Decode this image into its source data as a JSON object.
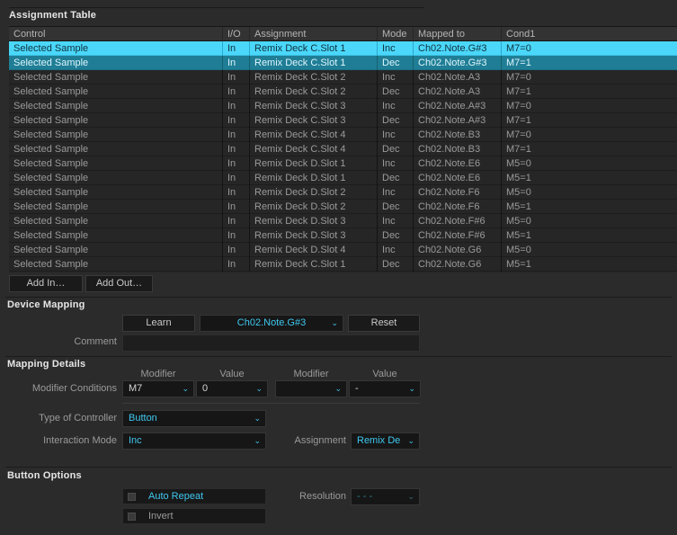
{
  "window": {
    "title": "Assignment Table"
  },
  "table": {
    "columns": [
      "Control",
      "I/O",
      "Assignment",
      "Mode",
      "Mapped to",
      "Cond1"
    ],
    "rows": [
      {
        "control": "Selected Sample",
        "io": "In",
        "assignment": "Remix Deck C.Slot 1",
        "mode": "Inc",
        "mapped": "Ch02.Note.G#3",
        "cond1": "M7=0",
        "state": "selected-primary"
      },
      {
        "control": "Selected Sample",
        "io": "In",
        "assignment": "Remix Deck C.Slot 1",
        "mode": "Dec",
        "mapped": "Ch02.Note.G#3",
        "cond1": "M7=1",
        "state": "selected-secondary"
      },
      {
        "control": "Selected Sample",
        "io": "In",
        "assignment": "Remix Deck C.Slot 2",
        "mode": "Inc",
        "mapped": "Ch02.Note.A3",
        "cond1": "M7=0",
        "state": "normal"
      },
      {
        "control": "Selected Sample",
        "io": "In",
        "assignment": "Remix Deck C.Slot 2",
        "mode": "Dec",
        "mapped": "Ch02.Note.A3",
        "cond1": "M7=1",
        "state": "normal"
      },
      {
        "control": "Selected Sample",
        "io": "In",
        "assignment": "Remix Deck C.Slot 3",
        "mode": "Inc",
        "mapped": "Ch02.Note.A#3",
        "cond1": "M7=0",
        "state": "normal"
      },
      {
        "control": "Selected Sample",
        "io": "In",
        "assignment": "Remix Deck C.Slot 3",
        "mode": "Dec",
        "mapped": "Ch02.Note.A#3",
        "cond1": "M7=1",
        "state": "normal"
      },
      {
        "control": "Selected Sample",
        "io": "In",
        "assignment": "Remix Deck C.Slot 4",
        "mode": "Inc",
        "mapped": "Ch02.Note.B3",
        "cond1": "M7=0",
        "state": "normal"
      },
      {
        "control": "Selected Sample",
        "io": "In",
        "assignment": "Remix Deck C.Slot 4",
        "mode": "Dec",
        "mapped": "Ch02.Note.B3",
        "cond1": "M7=1",
        "state": "normal"
      },
      {
        "control": "Selected Sample",
        "io": "In",
        "assignment": "Remix Deck D.Slot 1",
        "mode": "Inc",
        "mapped": "Ch02.Note.E6",
        "cond1": "M5=0",
        "state": "normal"
      },
      {
        "control": "Selected Sample",
        "io": "In",
        "assignment": "Remix Deck D.Slot 1",
        "mode": "Dec",
        "mapped": "Ch02.Note.E6",
        "cond1": "M5=1",
        "state": "normal"
      },
      {
        "control": "Selected Sample",
        "io": "In",
        "assignment": "Remix Deck D.Slot 2",
        "mode": "Inc",
        "mapped": "Ch02.Note.F6",
        "cond1": "M5=0",
        "state": "normal"
      },
      {
        "control": "Selected Sample",
        "io": "In",
        "assignment": "Remix Deck D.Slot 2",
        "mode": "Dec",
        "mapped": "Ch02.Note.F6",
        "cond1": "M5=1",
        "state": "normal"
      },
      {
        "control": "Selected Sample",
        "io": "In",
        "assignment": "Remix Deck D.Slot 3",
        "mode": "Inc",
        "mapped": "Ch02.Note.F#6",
        "cond1": "M5=0",
        "state": "normal"
      },
      {
        "control": "Selected Sample",
        "io": "In",
        "assignment": "Remix Deck D.Slot 3",
        "mode": "Dec",
        "mapped": "Ch02.Note.F#6",
        "cond1": "M5=1",
        "state": "normal"
      },
      {
        "control": "Selected Sample",
        "io": "In",
        "assignment": "Remix Deck D.Slot 4",
        "mode": "Inc",
        "mapped": "Ch02.Note.G6",
        "cond1": "M5=0",
        "state": "normal"
      },
      {
        "control": "Selected Sample",
        "io": "In",
        "assignment": "Remix Deck C.Slot 1",
        "mode": "Dec",
        "mapped": "Ch02.Note.G6",
        "cond1": "M5=1",
        "state": "normal"
      }
    ]
  },
  "table_actions": {
    "add_in": "Add In…",
    "add_out": "Add Out…"
  },
  "device_mapping": {
    "title": "Device Mapping",
    "learn_label": "Learn",
    "mapping_value": "Ch02.Note.G#3",
    "reset_label": "Reset",
    "comment_label": "Comment",
    "comment_value": ""
  },
  "mapping_details": {
    "title": "Mapping Details",
    "modifier_header_1": "Modifier",
    "value_header_1": "Value",
    "modifier_header_2": "Modifier",
    "value_header_2": "Value",
    "modifier_conditions_label": "Modifier Conditions",
    "modifier_1": "M7",
    "value_1": "0",
    "modifier_2": "",
    "value_2": "-",
    "type_of_controller_label": "Type of Controller",
    "type_of_controller": "Button",
    "interaction_mode_label": "Interaction Mode",
    "interaction_mode": "Inc",
    "assignment_label": "Assignment",
    "assignment_value": "Remix De"
  },
  "button_options": {
    "title": "Button Options",
    "auto_repeat_label": "Auto Repeat",
    "auto_repeat_checked": false,
    "invert_label": "Invert",
    "invert_checked": false,
    "resolution_label": "Resolution",
    "resolution_value": "- - -"
  },
  "icons": {
    "chevron_down": "⌄"
  },
  "colors": {
    "accent": "#3fc8f0",
    "selection_primary": "#4ad7fa",
    "selection_secondary": "#1f7e95",
    "background": "#2b2b2b",
    "panel": "#262626",
    "header_row": "#333333"
  }
}
